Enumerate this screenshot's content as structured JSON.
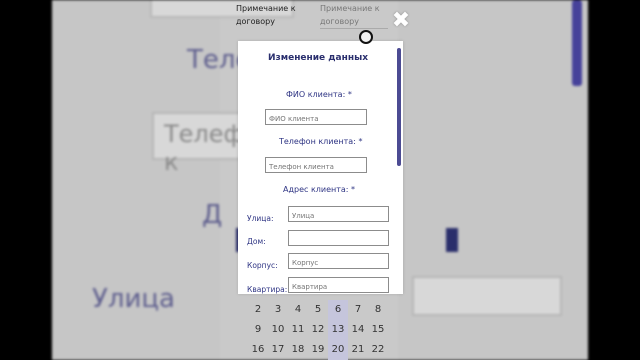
{
  "background": {
    "top_left_text": [
      "Примечание к",
      "договору"
    ],
    "top_right_text": [
      "Примечание к",
      "договору"
    ],
    "big_label_phone": "Теле",
    "big_input_phone": "Телефон к",
    "big_label_addr": "Д",
    "big_label_street": "Улица",
    "calendar_rows": [
      [
        "2",
        "3",
        "4",
        "5",
        "6",
        "7",
        "8"
      ],
      [
        "9",
        "10",
        "11",
        "12",
        "13",
        "14",
        "15"
      ],
      [
        "16",
        "17",
        "18",
        "19",
        "20",
        "21",
        "22"
      ]
    ]
  },
  "modal": {
    "title": "Изменение данных",
    "fio_label": "ФИО клиента:",
    "fio_placeholder": "ФИО клиента",
    "phone_label": "Телефон клиента:",
    "phone_placeholder": "Телефон клиента",
    "address_label": "Адрес клиента:",
    "required_mark": "*",
    "address_fields": [
      {
        "label": "Улица:",
        "placeholder": "Улица"
      },
      {
        "label": "Дом:",
        "placeholder": ""
      },
      {
        "label": "Корпус:",
        "placeholder": "Корпус"
      },
      {
        "label": "Квартира:",
        "placeholder": "Квартира"
      }
    ]
  },
  "icons": {
    "close": "close-icon",
    "cursor": "cursor-indicator"
  },
  "colors": {
    "accent": "#2f3584",
    "scrollbar": "#4c4b93"
  }
}
